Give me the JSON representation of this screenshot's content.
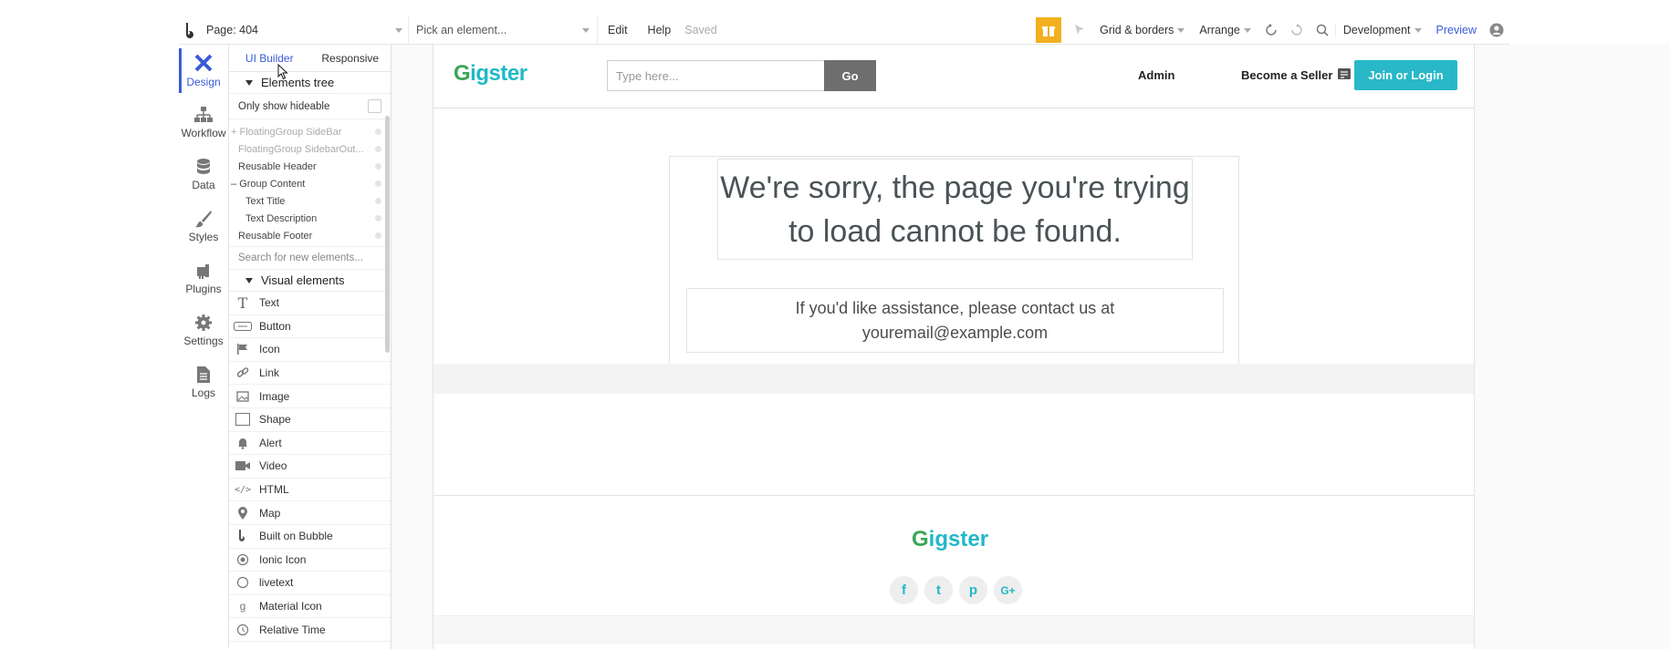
{
  "topbar": {
    "page_label": "Page: 404",
    "pick_placeholder": "Pick an element...",
    "menu_edit": "Edit",
    "menu_help": "Help",
    "saved": "Saved",
    "grid_borders": "Grid & borders",
    "arrange": "Arrange",
    "environment": "Development",
    "preview": "Preview"
  },
  "rail": {
    "items": [
      {
        "label": "Design"
      },
      {
        "label": "Workflow"
      },
      {
        "label": "Data"
      },
      {
        "label": "Styles"
      },
      {
        "label": "Plugins"
      },
      {
        "label": "Settings"
      },
      {
        "label": "Logs"
      }
    ]
  },
  "panel": {
    "tabs": [
      "UI Builder",
      "Responsive"
    ],
    "elements_tree": "Elements tree",
    "only_show_hideable": "Only show hideable",
    "tree": [
      {
        "label": "FloatingGroup SideBar"
      },
      {
        "label": "FloatingGroup SidebarOut..."
      },
      {
        "label": "Reusable Header"
      },
      {
        "label": "Group Content"
      },
      {
        "label": "Text Title"
      },
      {
        "label": "Text Description"
      },
      {
        "label": "Reusable Footer"
      }
    ],
    "search_placeholder": "Search for new elements...",
    "visual_elements": "Visual elements",
    "elements": [
      {
        "label": "Text"
      },
      {
        "label": "Button"
      },
      {
        "label": "Icon"
      },
      {
        "label": "Link"
      },
      {
        "label": "Image"
      },
      {
        "label": "Shape"
      },
      {
        "label": "Alert"
      },
      {
        "label": "Video"
      },
      {
        "label": "HTML"
      },
      {
        "label": "Map"
      },
      {
        "label": "Built on Bubble"
      },
      {
        "label": "Ionic Icon"
      },
      {
        "label": "livetext"
      },
      {
        "label": "Material Icon"
      },
      {
        "label": "Relative Time"
      }
    ]
  },
  "canvas": {
    "brand": "igster",
    "brand_g": "G",
    "search_placeholder": "Type here...",
    "go": "Go",
    "admin": "Admin",
    "become_seller": "Become a Seller",
    "join": "Join or Login",
    "title_line1": "We're sorry, the page you're trying",
    "title_line2": "to load cannot be found.",
    "desc_line1": "If you'd like assistance, please contact us at",
    "desc_line2": "youremail@example.com",
    "socials": [
      "f",
      "t",
      "p",
      "G+"
    ]
  },
  "colors": {
    "accent": "#3a5bd9",
    "brand": "#21b8c7",
    "gift": "#f2b01e"
  }
}
